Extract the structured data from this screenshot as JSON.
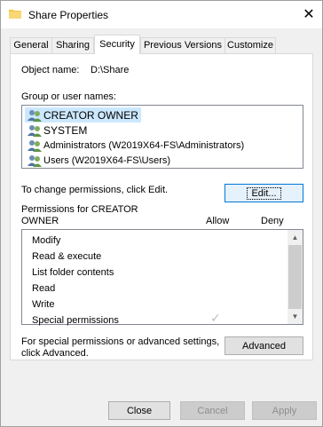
{
  "window": {
    "title": "Share Properties",
    "close_glyph": "✕"
  },
  "tabs": [
    {
      "label": "General"
    },
    {
      "label": "Sharing"
    },
    {
      "label": "Security"
    },
    {
      "label": "Previous Versions"
    },
    {
      "label": "Customize"
    }
  ],
  "object": {
    "label": "Object name:",
    "value": "D:\\Share"
  },
  "groups": {
    "label": "Group or user names:",
    "items": [
      {
        "name": "CREATOR OWNER",
        "icon": "user-group-icon"
      },
      {
        "name": "SYSTEM",
        "icon": "user-group-icon"
      },
      {
        "name": "Administrators (W2019X64-FS\\Administrators)",
        "icon": "user-group-icon"
      },
      {
        "name": "Users (W2019X64-FS\\Users)",
        "icon": "user-group-icon"
      }
    ]
  },
  "change_text": "To change permissions, click Edit.",
  "edit_button": "Edit...",
  "permissions": {
    "title_line1": "Permissions for CREATOR",
    "title_line2": "OWNER",
    "allow_header": "Allow",
    "deny_header": "Deny",
    "rows": [
      {
        "name": "Modify",
        "allow": false,
        "deny": false
      },
      {
        "name": "Read & execute",
        "allow": false,
        "deny": false
      },
      {
        "name": "List folder contents",
        "allow": false,
        "deny": false
      },
      {
        "name": "Read",
        "allow": false,
        "deny": false
      },
      {
        "name": "Write",
        "allow": false,
        "deny": false
      },
      {
        "name": "Special permissions",
        "allow": true,
        "deny": false
      }
    ],
    "check_glyph": "✓"
  },
  "advanced": {
    "text_line1": "For special permissions or advanced settings,",
    "text_line2": "click Advanced.",
    "button": "Advanced"
  },
  "footer": {
    "close": "Close",
    "cancel": "Cancel",
    "apply": "Apply"
  },
  "colors": {
    "focus_border": "#0078d7",
    "folder": "#f4c542"
  }
}
